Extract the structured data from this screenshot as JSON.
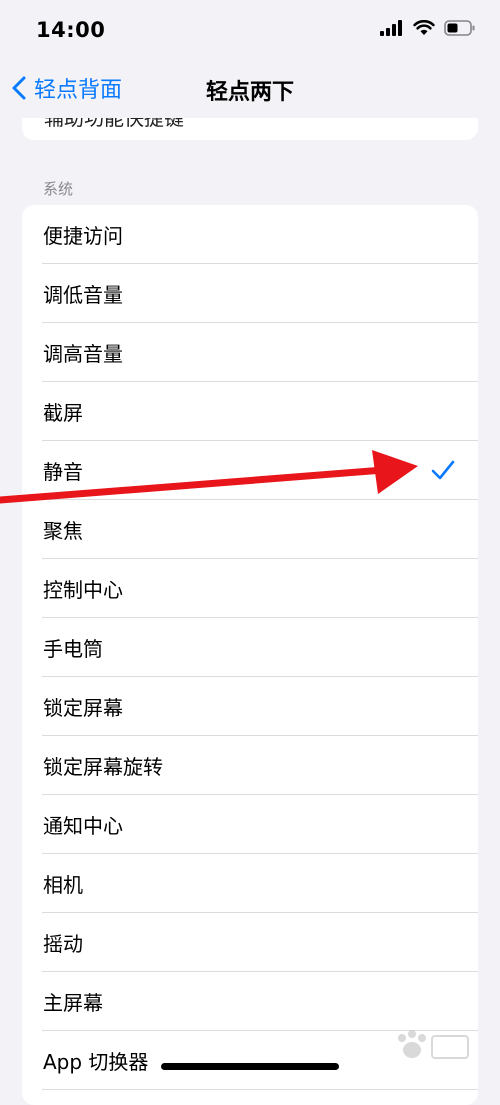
{
  "status_bar": {
    "time": "14:00"
  },
  "nav": {
    "back_label": "轻点背面",
    "title": "轻点两下"
  },
  "top_card": {
    "partial_text": "辅助功能快捷键"
  },
  "section": {
    "header": "系统"
  },
  "list": {
    "items": [
      {
        "label": "便捷访问",
        "checked": false
      },
      {
        "label": "调低音量",
        "checked": false
      },
      {
        "label": "调高音量",
        "checked": false
      },
      {
        "label": "截屏",
        "checked": false
      },
      {
        "label": "静音",
        "checked": true
      },
      {
        "label": "聚焦",
        "checked": false
      },
      {
        "label": "控制中心",
        "checked": false
      },
      {
        "label": "手电筒",
        "checked": false
      },
      {
        "label": "锁定屏幕",
        "checked": false
      },
      {
        "label": "锁定屏幕旋转",
        "checked": false
      },
      {
        "label": "通知中心",
        "checked": false
      },
      {
        "label": "相机",
        "checked": false
      },
      {
        "label": "摇动",
        "checked": false
      },
      {
        "label": "主屏幕",
        "checked": false
      },
      {
        "label": "App 切换器",
        "checked": false
      }
    ]
  },
  "colors": {
    "accent": "#0a7aff",
    "background": "#f2f2f7",
    "annotation": "#e8151b"
  },
  "icons": {
    "signal": "cellular-signal-icon",
    "wifi": "wifi-icon",
    "battery": "battery-icon",
    "back": "chevron-left-icon",
    "check": "checkmark-icon"
  }
}
